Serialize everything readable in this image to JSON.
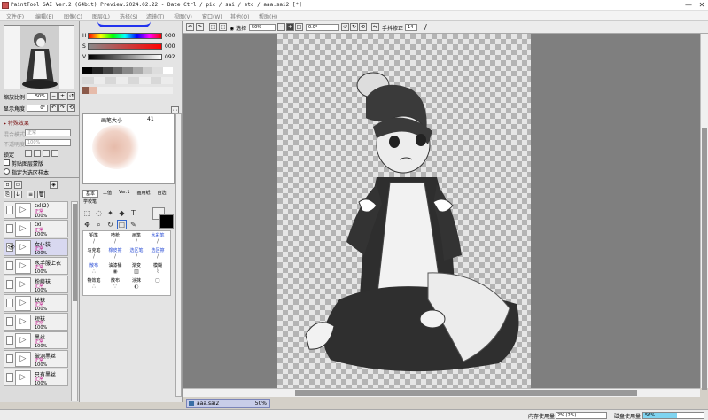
{
  "titlebar": {
    "text": "PaintTool SAI Ver.2 (64bit) Preview.2024.02.22 - Date Ctrl / pic / sai / etc / aaa.sai2 [*]",
    "minimize": "—",
    "close": "✕"
  },
  "menu": [
    "文件(F)",
    "编辑(E)",
    "图像(C)",
    "图层(L)",
    "选择(S)",
    "滤镜(T)",
    "视图(V)",
    "窗口(W)",
    "其他(O)",
    "帮助(H)"
  ],
  "navigator": {
    "zoom_label": "缩放比例",
    "zoom_value": "50%",
    "angle_label": "显示角度",
    "angle_value": "0°"
  },
  "layers_panel": {
    "effects_header": "特殊效果",
    "blend_mode_label": "混合模式",
    "blend_mode_value": "正常",
    "opacity_label": "不透明度",
    "opacity_value": "100%",
    "lock_label": "锁定",
    "clip_label": "剪贴图层蒙版",
    "select_source_label": "指定为选区样本",
    "layers": [
      {
        "name": "txl(2)",
        "mode": "正常",
        "opacity": "100%",
        "visible": false
      },
      {
        "name": "txl",
        "mode": "正常",
        "opacity": "100%",
        "visible": false
      },
      {
        "name": "女仆装",
        "mode": "正常",
        "opacity": "100%",
        "visible": true
      },
      {
        "name": "水手服上衣",
        "mode": "正常",
        "opacity": "100%",
        "visible": false
      },
      {
        "name": "粉藤袜",
        "mode": "正常",
        "opacity": "100%",
        "visible": false
      },
      {
        "name": "长袜",
        "mode": "正常",
        "opacity": "100%",
        "visible": false
      },
      {
        "name": "短袜",
        "mode": "正常",
        "opacity": "100%",
        "visible": false
      },
      {
        "name": "黑丝",
        "mode": "正常",
        "opacity": "100%",
        "visible": false
      },
      {
        "name": "破洞黑丝",
        "mode": "正常",
        "opacity": "100%",
        "visible": false
      },
      {
        "name": "只有黑丝",
        "mode": "正常",
        "opacity": "100%",
        "visible": false
      }
    ]
  },
  "color_panel": {
    "h_label": "H",
    "h_value": "000",
    "s_label": "S",
    "s_value": "000",
    "v_label": "V",
    "v_value": "092"
  },
  "brush_panel": {
    "size_label": "画笔大小",
    "size_value": "41",
    "tabs": [
      "基本",
      "二值",
      "Ver.1",
      "画用纸",
      "自选"
    ],
    "tab2": "学校笔",
    "brushes": [
      "铅笔",
      "喷枪",
      "画笔",
      "水彩笔",
      "马克笔",
      "橡皮擦",
      "选区笔",
      "选区擦",
      "散布",
      "油漆桶",
      "渐变",
      "模糊",
      "特效笔",
      "散布",
      "涂抹",
      "",
      ""
    ]
  },
  "toolbar": {
    "zoom_value": "50%",
    "angle_value": "0.0°",
    "select_label": "选择",
    "stabilizer_label": "手抖修正",
    "stabilizer_value": "14"
  },
  "document": {
    "name": "aaa.sai2",
    "zoom": "50%"
  },
  "status": {
    "memory_label": "内存使用量",
    "memory_value": "2% (2%)",
    "disk_label": "磁盘使用量",
    "disk_value": "56%"
  },
  "colors": {
    "accent": "#3a6ea5",
    "canvas_bg": "#7f7f7f",
    "skin_swatch": "#e6bbaa"
  }
}
